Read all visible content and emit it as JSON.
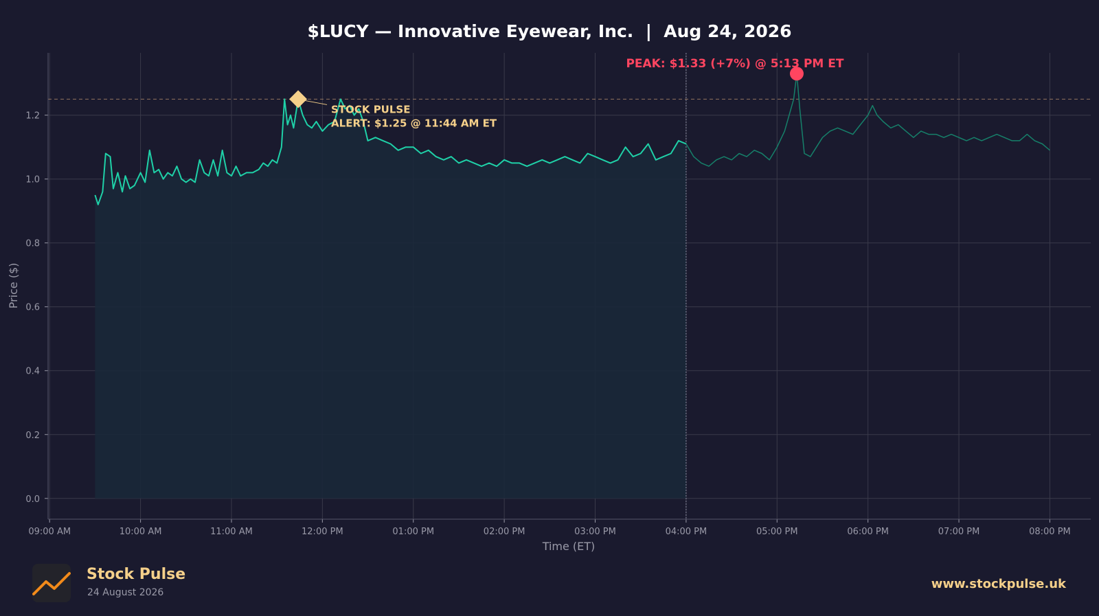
{
  "colors": {
    "background": "#1a1a2e",
    "line_regular": "#1fd1a8",
    "line_after_hours": "#16806a",
    "fill": "#1a2838",
    "alert": "#f5d08a",
    "peak": "#ff4560",
    "grid": "#3a3a4a",
    "text": "#ffffff",
    "muted": "#9a9aa8"
  },
  "footer": {
    "brand": "Stock Pulse",
    "date": "24 August 2026",
    "url": "www.stockpulse.uk",
    "logo_icon": "line-chart-icon"
  },
  "chart_data": {
    "type": "line",
    "title": "$LUCY — Innovative Eyewear, Inc.  |  Aug 24, 2026",
    "xlabel": "Time (ET)",
    "ylabel": "Price ($)",
    "x_tick_labels": [
      "09:00 AM",
      "10:00 AM",
      "11:00 AM",
      "12:00 PM",
      "01:00 PM",
      "02:00 PM",
      "03:00 PM",
      "04:00 PM",
      "05:00 PM",
      "06:00 PM",
      "07:00 PM",
      "08:00 PM"
    ],
    "y_ticks": [
      0.0,
      0.2,
      0.4,
      0.6,
      0.8,
      1.0,
      1.2
    ],
    "xlim": [
      "08:59",
      "20:27"
    ],
    "ylim": [
      -0.065,
      1.395
    ],
    "grid": true,
    "regular_session_end": "16:00",
    "alert_line": 1.25,
    "series": [
      {
        "session": "regular",
        "points": [
          [
            "09:30",
            0.95
          ],
          [
            "09:32",
            0.92
          ],
          [
            "09:35",
            0.96
          ],
          [
            "09:37",
            1.08
          ],
          [
            "09:40",
            1.07
          ],
          [
            "09:42",
            0.97
          ],
          [
            "09:45",
            1.02
          ],
          [
            "09:48",
            0.96
          ],
          [
            "09:50",
            1.01
          ],
          [
            "09:53",
            0.97
          ],
          [
            "09:56",
            0.98
          ],
          [
            "10:00",
            1.02
          ],
          [
            "10:03",
            0.99
          ],
          [
            "10:06",
            1.09
          ],
          [
            "10:09",
            1.02
          ],
          [
            "10:12",
            1.03
          ],
          [
            "10:15",
            1.0
          ],
          [
            "10:18",
            1.02
          ],
          [
            "10:21",
            1.01
          ],
          [
            "10:24",
            1.04
          ],
          [
            "10:27",
            1.0
          ],
          [
            "10:30",
            0.99
          ],
          [
            "10:33",
            1.0
          ],
          [
            "10:36",
            0.99
          ],
          [
            "10:39",
            1.06
          ],
          [
            "10:42",
            1.02
          ],
          [
            "10:45",
            1.01
          ],
          [
            "10:48",
            1.06
          ],
          [
            "10:51",
            1.01
          ],
          [
            "10:54",
            1.09
          ],
          [
            "10:57",
            1.02
          ],
          [
            "11:00",
            1.01
          ],
          [
            "11:03",
            1.04
          ],
          [
            "11:06",
            1.01
          ],
          [
            "11:10",
            1.02
          ],
          [
            "11:14",
            1.02
          ],
          [
            "11:18",
            1.03
          ],
          [
            "11:21",
            1.05
          ],
          [
            "11:24",
            1.04
          ],
          [
            "11:27",
            1.06
          ],
          [
            "11:30",
            1.05
          ],
          [
            "11:33",
            1.1
          ],
          [
            "11:35",
            1.25
          ],
          [
            "11:37",
            1.17
          ],
          [
            "11:39",
            1.2
          ],
          [
            "11:41",
            1.16
          ],
          [
            "11:44",
            1.25
          ],
          [
            "11:47",
            1.2
          ],
          [
            "11:50",
            1.17
          ],
          [
            "11:53",
            1.16
          ],
          [
            "11:56",
            1.18
          ],
          [
            "12:00",
            1.15
          ],
          [
            "12:04",
            1.17
          ],
          [
            "12:08",
            1.18
          ],
          [
            "12:12",
            1.25
          ],
          [
            "12:15",
            1.22
          ],
          [
            "12:18",
            1.23
          ],
          [
            "12:21",
            1.2
          ],
          [
            "12:24",
            1.22
          ],
          [
            "12:27",
            1.18
          ],
          [
            "12:30",
            1.12
          ],
          [
            "12:35",
            1.13
          ],
          [
            "12:40",
            1.12
          ],
          [
            "12:45",
            1.11
          ],
          [
            "12:50",
            1.09
          ],
          [
            "12:55",
            1.1
          ],
          [
            "13:00",
            1.1
          ],
          [
            "13:05",
            1.08
          ],
          [
            "13:10",
            1.09
          ],
          [
            "13:15",
            1.07
          ],
          [
            "13:20",
            1.06
          ],
          [
            "13:25",
            1.07
          ],
          [
            "13:30",
            1.05
          ],
          [
            "13:35",
            1.06
          ],
          [
            "13:40",
            1.05
          ],
          [
            "13:45",
            1.04
          ],
          [
            "13:50",
            1.05
          ],
          [
            "13:55",
            1.04
          ],
          [
            "14:00",
            1.06
          ],
          [
            "14:05",
            1.05
          ],
          [
            "14:10",
            1.05
          ],
          [
            "14:15",
            1.04
          ],
          [
            "14:20",
            1.05
          ],
          [
            "14:25",
            1.06
          ],
          [
            "14:30",
            1.05
          ],
          [
            "14:35",
            1.06
          ],
          [
            "14:40",
            1.07
          ],
          [
            "14:45",
            1.06
          ],
          [
            "14:50",
            1.05
          ],
          [
            "14:55",
            1.08
          ],
          [
            "15:00",
            1.07
          ],
          [
            "15:05",
            1.06
          ],
          [
            "15:10",
            1.05
          ],
          [
            "15:15",
            1.06
          ],
          [
            "15:20",
            1.1
          ],
          [
            "15:25",
            1.07
          ],
          [
            "15:30",
            1.08
          ],
          [
            "15:35",
            1.11
          ],
          [
            "15:40",
            1.06
          ],
          [
            "15:45",
            1.07
          ],
          [
            "15:50",
            1.08
          ],
          [
            "15:55",
            1.12
          ],
          [
            "16:00",
            1.11
          ]
        ]
      },
      {
        "session": "after-hours",
        "points": [
          [
            "16:00",
            1.11
          ],
          [
            "16:05",
            1.07
          ],
          [
            "16:10",
            1.05
          ],
          [
            "16:15",
            1.04
          ],
          [
            "16:20",
            1.06
          ],
          [
            "16:25",
            1.07
          ],
          [
            "16:30",
            1.06
          ],
          [
            "16:35",
            1.08
          ],
          [
            "16:40",
            1.07
          ],
          [
            "16:45",
            1.09
          ],
          [
            "16:50",
            1.08
          ],
          [
            "16:55",
            1.06
          ],
          [
            "17:00",
            1.1
          ],
          [
            "17:05",
            1.15
          ],
          [
            "17:08",
            1.2
          ],
          [
            "17:11",
            1.25
          ],
          [
            "17:13",
            1.33
          ],
          [
            "17:15",
            1.22
          ],
          [
            "17:18",
            1.08
          ],
          [
            "17:22",
            1.07
          ],
          [
            "17:26",
            1.1
          ],
          [
            "17:30",
            1.13
          ],
          [
            "17:35",
            1.15
          ],
          [
            "17:40",
            1.16
          ],
          [
            "17:45",
            1.15
          ],
          [
            "17:50",
            1.14
          ],
          [
            "17:55",
            1.17
          ],
          [
            "18:00",
            1.2
          ],
          [
            "18:03",
            1.23
          ],
          [
            "18:06",
            1.2
          ],
          [
            "18:10",
            1.18
          ],
          [
            "18:15",
            1.16
          ],
          [
            "18:20",
            1.17
          ],
          [
            "18:25",
            1.15
          ],
          [
            "18:30",
            1.13
          ],
          [
            "18:35",
            1.15
          ],
          [
            "18:40",
            1.14
          ],
          [
            "18:45",
            1.14
          ],
          [
            "18:50",
            1.13
          ],
          [
            "18:55",
            1.14
          ],
          [
            "19:00",
            1.13
          ],
          [
            "19:05",
            1.12
          ],
          [
            "19:10",
            1.13
          ],
          [
            "19:15",
            1.12
          ],
          [
            "19:20",
            1.13
          ],
          [
            "19:25",
            1.14
          ],
          [
            "19:30",
            1.13
          ],
          [
            "19:35",
            1.12
          ],
          [
            "19:40",
            1.12
          ],
          [
            "19:45",
            1.14
          ],
          [
            "19:50",
            1.12
          ],
          [
            "19:55",
            1.11
          ],
          [
            "20:00",
            1.09
          ]
        ]
      }
    ],
    "annotations": [
      {
        "kind": "alert",
        "x": "11:44",
        "y": 1.25,
        "lines": [
          "STOCK PULSE",
          "ALERT: $1.25 @ 11:44 AM ET"
        ]
      },
      {
        "kind": "peak",
        "x": "17:13",
        "y": 1.33,
        "text": "PEAK: $1.33 (+7%) @ 5:13 PM ET"
      }
    ]
  }
}
